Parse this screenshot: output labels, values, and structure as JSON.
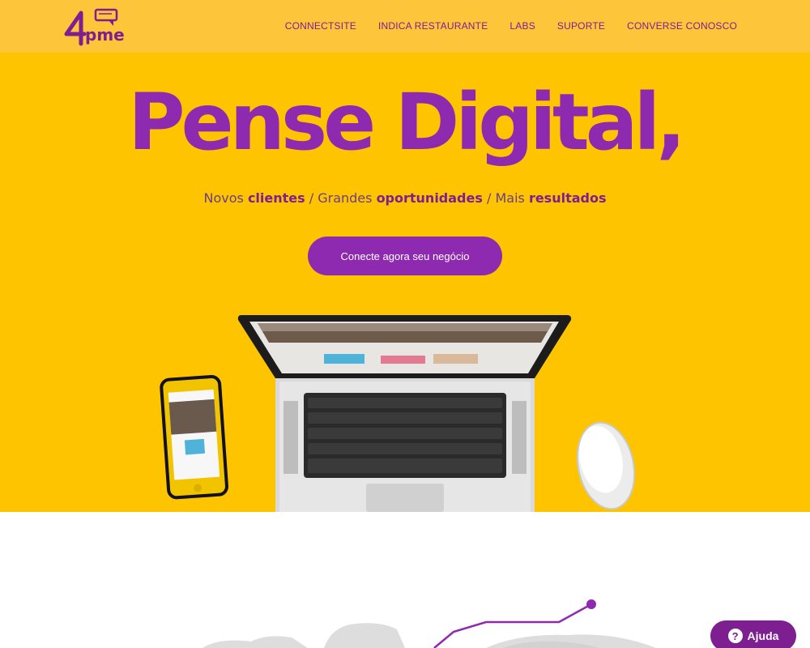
{
  "brand": {
    "logo_text": "4pme",
    "primary_color": "#8e2ab0",
    "accent_color": "#ffc400",
    "header_color": "#fdc53a"
  },
  "nav": {
    "items": [
      {
        "label": "CONNECTSITE"
      },
      {
        "label": "INDICA RESTAURANTE"
      },
      {
        "label": "LABS"
      },
      {
        "label": "SUPORTE"
      },
      {
        "label": "CONVERSE CONOSCO"
      }
    ]
  },
  "hero": {
    "headline": "Pense Digital,",
    "subline": {
      "p1": "Novos ",
      "b1": "clientes",
      "p2": " / Grandes ",
      "b2": "oportunidades",
      "p3": " / Mais ",
      "b3": "resultados"
    },
    "cta_label": "Conecte agora seu negócio"
  },
  "help_widget": {
    "icon": "question-icon",
    "icon_glyph": "?",
    "label": "Ajuda"
  }
}
